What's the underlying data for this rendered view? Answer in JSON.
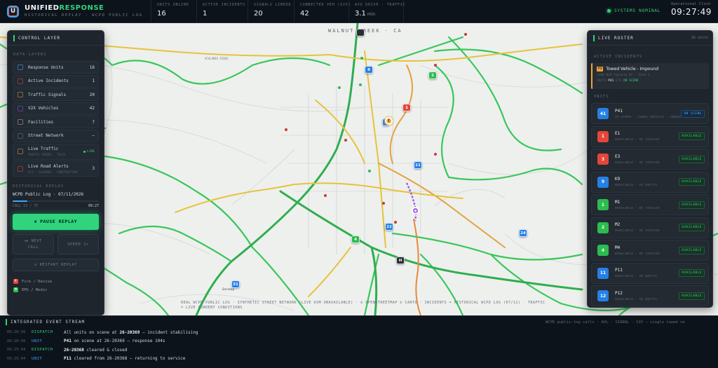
{
  "app": {
    "title_main": "UNIFIED",
    "title_accent": "RESPONSE",
    "subtitle": "HISTORICAL REPLAY · WCPD PUBLIC LOG",
    "logo_letter": "U"
  },
  "stats": [
    {
      "label": "UNITS ONLINE",
      "value": "16",
      "unit": ""
    },
    {
      "label": "ACTIVE INCIDENTS",
      "value": "1",
      "unit": ""
    },
    {
      "label": "SIGNALS LINKED",
      "value": "20",
      "unit": ""
    },
    {
      "label": "CONNECTED VEH (V2X)",
      "value": "42",
      "unit": ""
    },
    {
      "label": "AVG DRIVE · TRAFFIC",
      "value": "3.1",
      "unit": "min"
    }
  ],
  "system": {
    "status": "SYSTEMS NOMINAL",
    "clock_label": "Operational Clock",
    "clock": "09:27:49"
  },
  "map": {
    "city": "WALNUT CREEK · CA",
    "acalanes": "ACALANES RIDGE",
    "saranap": "Saranap",
    "attribution": "REAL WCPD PUBLIC LOG · SYNTHETIC STREET NETWORK (LIVE OSM UNAVAILABLE) · © OPENSTREETMAP © CARTO · INCIDENTS = HISTORICAL WCPD LOG (07/11) · TRAFFIC = LIVE CURRENT CONDITIONS",
    "markers": [
      "9",
      "2",
      "1",
      "11",
      "22",
      "4",
      "24",
      "31",
      "H"
    ]
  },
  "control": {
    "title": "CONTROL LAYER",
    "data_layers_label": "DATA LAYERS",
    "layers": [
      {
        "name": "Response Units",
        "count": "16",
        "color": "#3aa7ff"
      },
      {
        "name": "Active Incidents",
        "count": "1",
        "color": "#e3463a"
      },
      {
        "name": "Traffic Signals",
        "count": "20",
        "color": "#f0a53a"
      },
      {
        "name": "V2X Vehicles",
        "count": "42",
        "color": "#a05ae8"
      },
      {
        "name": "Facilities",
        "count": "7",
        "color": "#d8dee4"
      },
      {
        "name": "Street Network",
        "count": "—",
        "color": "#8a96a2"
      }
    ],
    "live_traffic": {
      "name": "Live Traffic",
      "sub": "TRAFFIC SPEEDS · TILES",
      "status": "LIVE"
    },
    "road_alerts": {
      "name": "Live Road Alerts",
      "sub": "511 · CLOSURES · CONSTRUCTION",
      "count": "3"
    },
    "replay_label": "HISTORICAL REPLAY",
    "replay_log": "WCPD Public Log · 07/11/2026",
    "progress_pct": 17,
    "call_counter": "CALL 13 / 75",
    "call_time": "09:27",
    "pause_label": "⏸ PAUSE REPLAY",
    "next_label_1": "⏭ NEXT",
    "next_label_2": "CALL",
    "speed_label": "SPEED 1×",
    "restart_label": "↺ RESTART REPLAY",
    "legend": [
      {
        "label": "Fire / Rescue",
        "color": "#e3463a",
        "glyph": "F"
      },
      {
        "label": "EMS / Medic",
        "color": "#2cbc4f",
        "glyph": "M"
      }
    ]
  },
  "roster": {
    "title": "LIVE ROSTER",
    "count": "16 units",
    "active_label": "ACTIVE INCIDENTS",
    "incident": {
      "priority": "P3",
      "title": "Towed Vehicle - Impound",
      "meta": "1300 BLK Ygnacio Dr · Zone 1",
      "units_label": "UNITS",
      "unit": "P41",
      "eta": "ETA",
      "status": "ON SCENE"
    },
    "units_label": "UNITS",
    "units": [
      {
        "id": "P41",
        "icon": "41",
        "status": "On scene · Towed Vehicle - Impound",
        "badge": "ON SCENE",
        "color": "#2580e6",
        "badge_type": "on"
      },
      {
        "id": "E1",
        "icon": "1",
        "status": "Available · at station",
        "badge": "AVAILABLE",
        "color": "#e3463a",
        "badge_type": "av"
      },
      {
        "id": "E3",
        "icon": "3",
        "status": "Available · at station",
        "badge": "AVAILABLE",
        "color": "#e3463a",
        "badge_type": "av"
      },
      {
        "id": "K9",
        "icon": "9",
        "status": "Available · on patrol",
        "badge": "AVAILABLE",
        "color": "#2580e6",
        "badge_type": "av"
      },
      {
        "id": "M1",
        "icon": "1",
        "status": "Available · at station",
        "badge": "AVAILABLE",
        "color": "#2cbc4f",
        "badge_type": "av"
      },
      {
        "id": "M2",
        "icon": "2",
        "status": "Available · at station",
        "badge": "AVAILABLE",
        "color": "#2cbc4f",
        "badge_type": "av"
      },
      {
        "id": "M4",
        "icon": "4",
        "status": "Available · at station",
        "badge": "AVAILABLE",
        "color": "#2cbc4f",
        "badge_type": "av"
      },
      {
        "id": "P11",
        "icon": "11",
        "status": "Available · on patrol",
        "badge": "AVAILABLE",
        "color": "#2580e6",
        "badge_type": "av"
      },
      {
        "id": "P12",
        "icon": "12",
        "status": "Available · on patrol",
        "badge": "AVAILABLE",
        "color": "#2580e6",
        "badge_type": "av"
      }
    ]
  },
  "stream": {
    "title": "INTEGRATED EVENT STREAM",
    "right": "WCPD public-log calls · AVL · SIGNAL · V2X — single towed ve",
    "events": [
      {
        "time": "09:26:56",
        "type": "DISPATCH",
        "pre": "All units on scene at ",
        "bold": "26-20369",
        "post": " — incident stabilising"
      },
      {
        "time": "09:26:56",
        "type": "UNIT",
        "pre": "",
        "bold": "P41",
        "post": " on scene at 26-20369 — response 104s"
      },
      {
        "time": "09:25:04",
        "type": "DISPATCH",
        "pre": "",
        "bold": "26-20368",
        "post": " cleared & closed"
      },
      {
        "time": "09:25:04",
        "type": "UNIT",
        "pre": "",
        "bold": "P11",
        "post": " cleared from 26-20368 — returning to service"
      }
    ]
  }
}
